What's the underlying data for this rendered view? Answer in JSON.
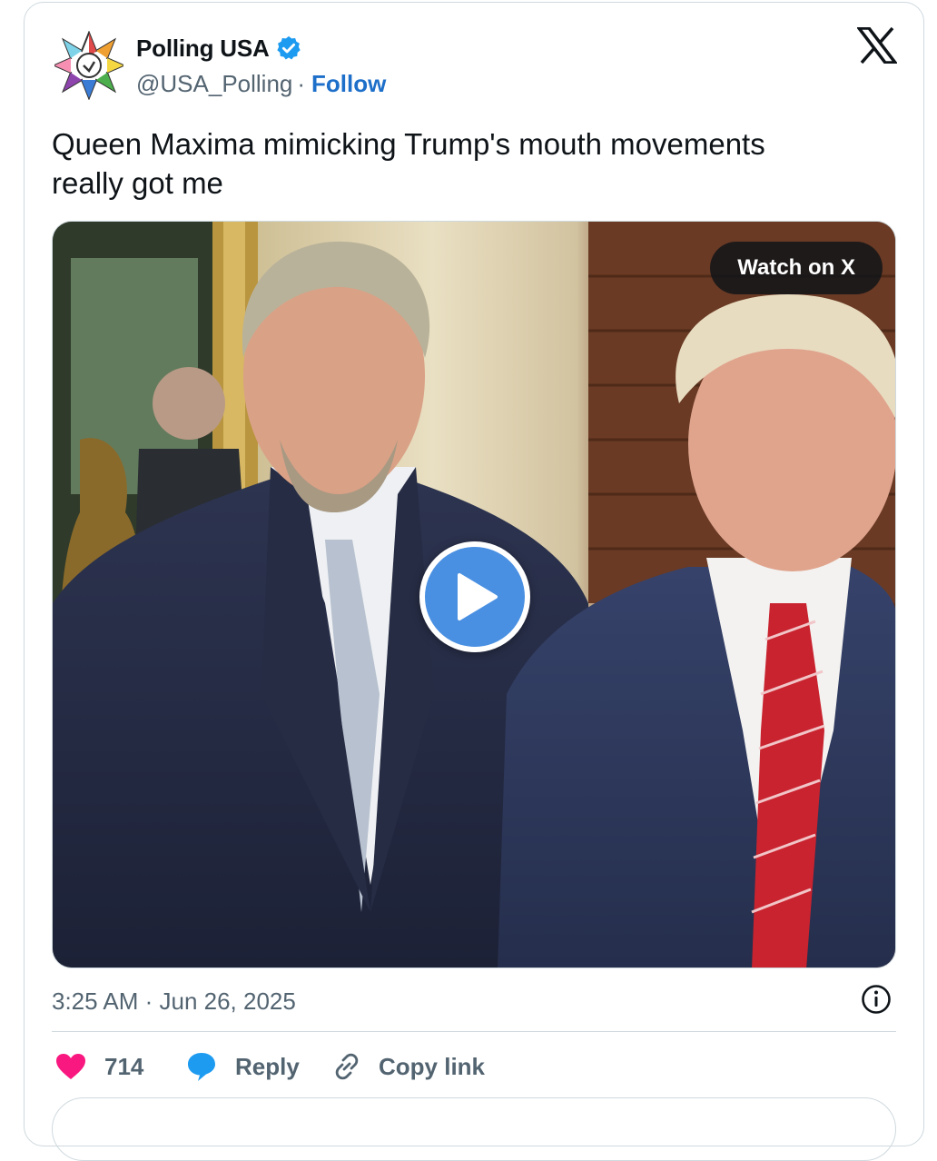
{
  "author": {
    "name": "Polling USA",
    "handle": "@USA_Polling",
    "separator": "·",
    "follow_label": "Follow",
    "verified": true
  },
  "tweet": {
    "text_line1": "Queen Maxima mimicking Trump's mouth movements",
    "text_line2": "really got me"
  },
  "media": {
    "watch_label": "Watch on X",
    "type": "video"
  },
  "footer": {
    "timestamp": "3:25 AM · Jun 26, 2025",
    "likes": "714",
    "reply_label": "Reply",
    "copy_label": "Copy link"
  },
  "colors": {
    "accent": "#1d9bf0",
    "follow": "#1d6fc9",
    "like": "#f91880",
    "play": "#4a90e2",
    "muted": "#536471"
  },
  "icons": [
    "polling-usa-logo",
    "verified-badge-icon",
    "x-logo-icon",
    "play-icon",
    "info-icon",
    "heart-icon",
    "reply-bubble-icon",
    "link-icon"
  ]
}
